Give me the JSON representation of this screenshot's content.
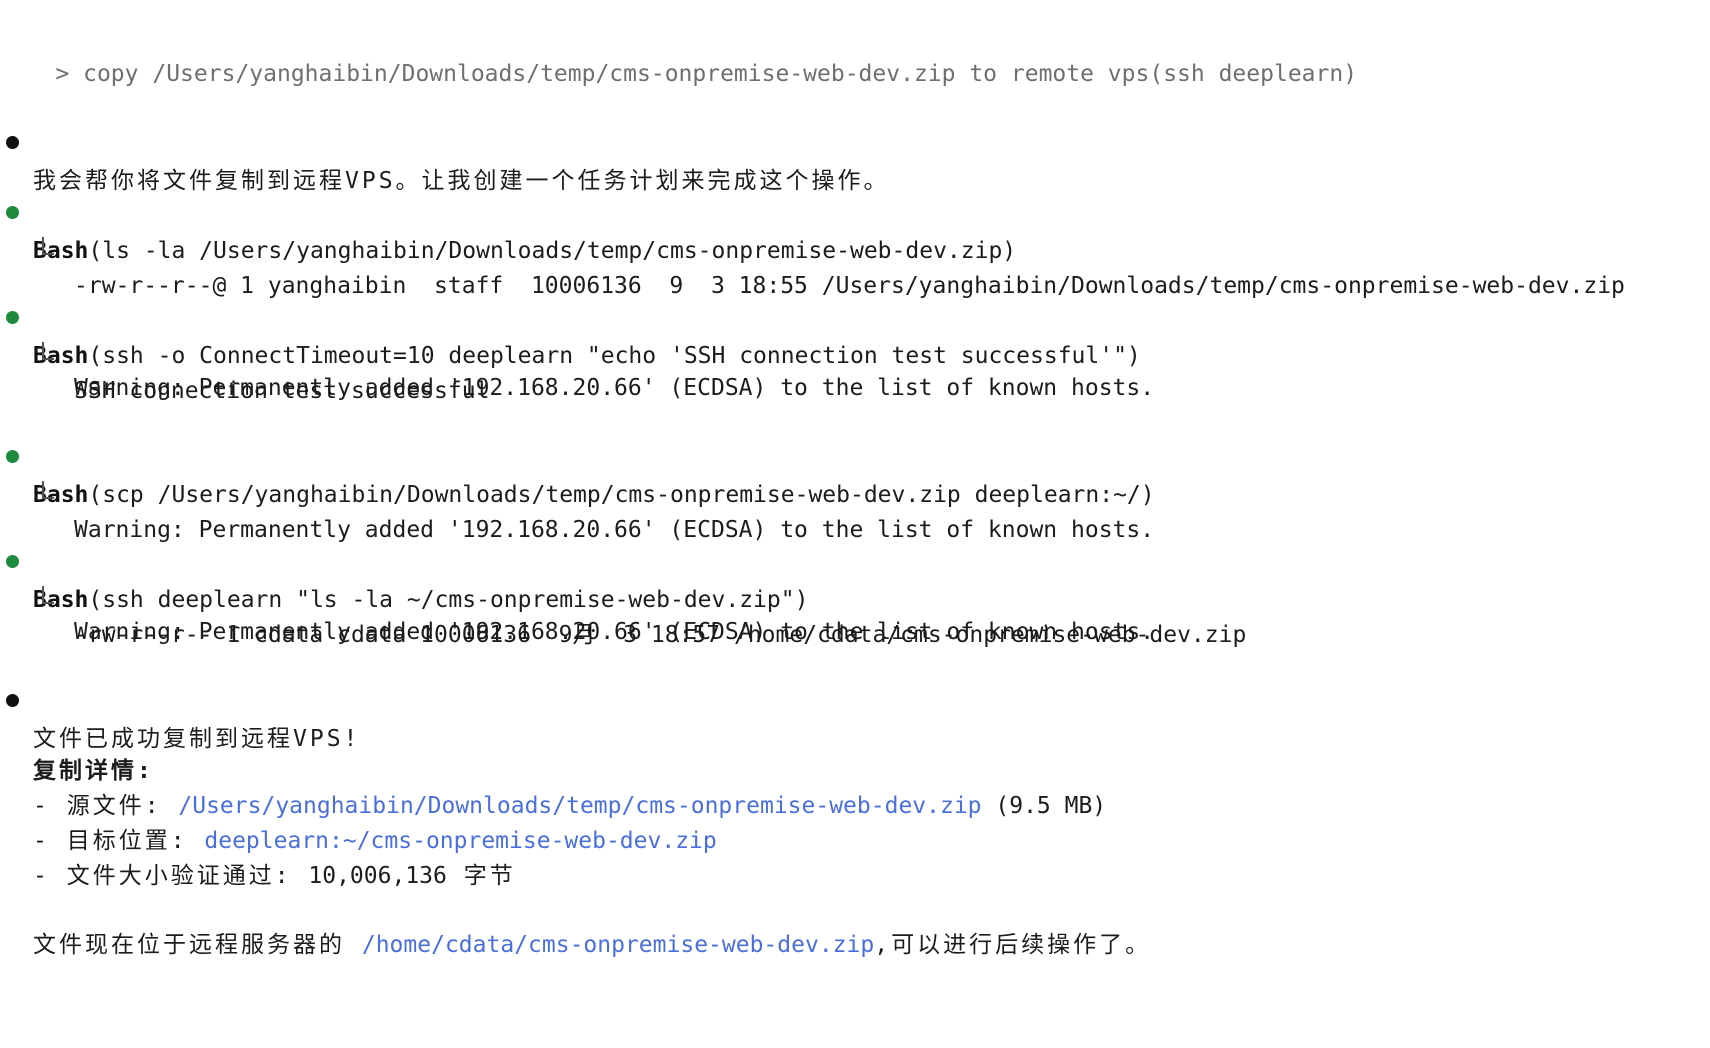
{
  "prompt": {
    "symbol": ">",
    "text": "copy /Users/yanghaibin/Downloads/temp/cms-onpremise-web-dev.zip to remote vps(ssh deeplearn)"
  },
  "intro_message": "我会帮你将文件复制到远程VPS。让我创建一个任务计划来完成这个操作。",
  "tool_calls": [
    {
      "tool": "Bash",
      "args": "(ls -la /Users/yanghaibin/Downloads/temp/cms-onpremise-web-dev.zip)",
      "output": [
        "-rw-r--r--@ 1 yanghaibin  staff  10006136  9  3 18:55 /Users/yanghaibin/Downloads/temp/cms-onpremise-web-dev.zip"
      ]
    },
    {
      "tool": "Bash",
      "args": "(ssh -o ConnectTimeout=10 deeplearn \"echo 'SSH connection test successful'\")",
      "output": [
        "SSH connection test successful",
        "Warning: Permanently added '192.168.20.66' (ECDSA) to the list of known hosts."
      ]
    },
    {
      "tool": "Bash",
      "args": "(scp /Users/yanghaibin/Downloads/temp/cms-onpremise-web-dev.zip deeplearn:~/)",
      "output": [
        "Warning: Permanently added '192.168.20.66' (ECDSA) to the list of known hosts."
      ]
    },
    {
      "tool": "Bash",
      "args": "(ssh deeplearn \"ls -la ~/cms-onpremise-web-dev.zip\")",
      "output": [
        "-rw-r--r-- 1 cdata cdata 10006136  9月  3 18:57 /home/cdata/cms-onpremise-web-dev.zip",
        "Warning: Permanently added '192.168.20.66' (ECDSA) to the list of known hosts."
      ]
    }
  ],
  "summary": {
    "headline": "文件已成功复制到远程VPS!",
    "details_title": "复制详情:",
    "source": {
      "prefix": "- 源文件: ",
      "path": "/Users/yanghaibin/Downloads/temp/cms-onpremise-web-dev.zip",
      "suffix": " (9.5 MB)"
    },
    "target": {
      "prefix": "- 目标位置: ",
      "path": "deeplearn:~/cms-onpremise-web-dev.zip"
    },
    "verify": {
      "prefix": "- 文件大小验证通过: ",
      "value": "10,006,136",
      "suffix": " 字节"
    },
    "final": {
      "prefix": "文件现在位于远程服务器的 ",
      "path": "/home/cdata/cms-onpremise-web-dev.zip",
      "suffix": ",可以进行后续操作了。"
    }
  },
  "colors": {
    "bullet_message": "#111111",
    "bullet_tool": "#1e8a3c",
    "link": "#4a6fdc",
    "prompt_text": "#6f6f6f"
  }
}
